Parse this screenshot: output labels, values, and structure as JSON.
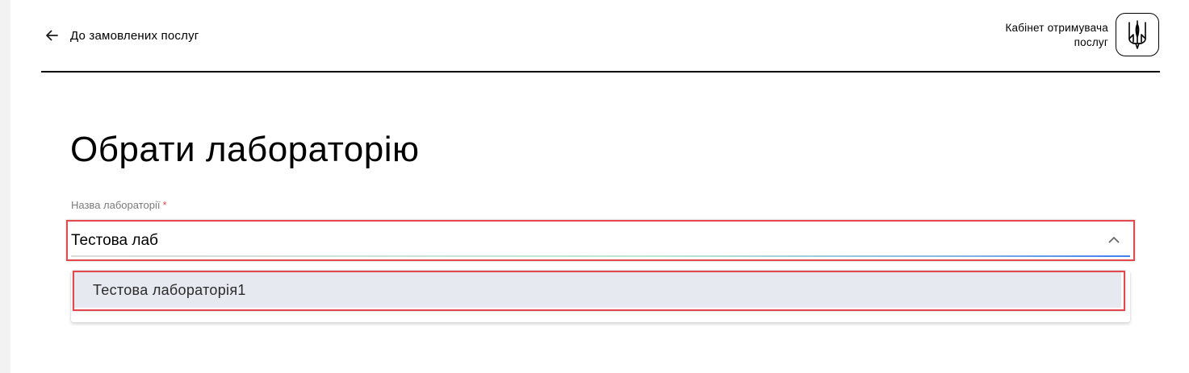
{
  "header": {
    "back_label": "До замовлених послуг",
    "cabinet_line1": "Кабінет отримувача",
    "cabinet_line2": "послуг"
  },
  "icons": {
    "back": "arrow-left-icon",
    "emblem": "trident-emblem-icon",
    "chevron": "chevron-up-icon"
  },
  "main": {
    "title": "Обрати лабораторію",
    "field": {
      "label": "Назва лабораторії",
      "required_mark": "*",
      "value": "Тестова лаб"
    },
    "dropdown": {
      "options": [
        {
          "label": "Тестова лабораторія1"
        }
      ]
    }
  },
  "colors": {
    "highlight": "#e4474d",
    "option_background": "#e6e9ef",
    "underline_focus": "#3f7ff0",
    "label_gray": "#7a7a7a",
    "required": "#e04b4b"
  }
}
